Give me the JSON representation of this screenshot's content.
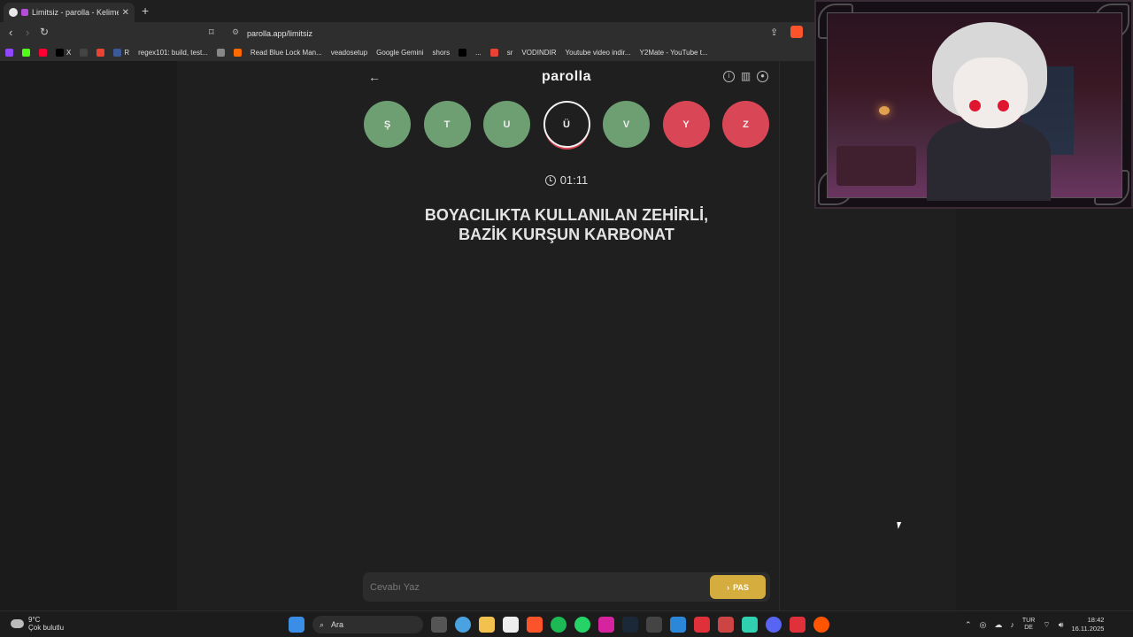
{
  "browser": {
    "tab_title": "Limitsiz - parolla - Kelime oyu",
    "new_tab": "+",
    "url": "parolla.app/limitsiz",
    "bookmarks": [
      {
        "label": "",
        "color": "#9146ff"
      },
      {
        "label": "",
        "color": "#53fc18"
      },
      {
        "label": "",
        "color": "#ff0033"
      },
      {
        "label": "X",
        "color": "#000000"
      },
      {
        "label": "",
        "color": "#444444"
      },
      {
        "label": "",
        "color": "#ea4335"
      },
      {
        "label": "R",
        "color": "#3b5998"
      },
      {
        "label": "regex101: build, test...",
        "color": ""
      },
      {
        "label": "",
        "color": "#888888"
      },
      {
        "label": "",
        "color": "#ff6a00"
      },
      {
        "label": "Read Blue Lock Man...",
        "color": ""
      },
      {
        "label": "veadosetup",
        "color": ""
      },
      {
        "label": "Google Gemini",
        "color": ""
      },
      {
        "label": "shors",
        "color": ""
      },
      {
        "label": "",
        "color": "#000000"
      },
      {
        "label": "...",
        "color": ""
      },
      {
        "label": "",
        "color": "#ea4335"
      },
      {
        "label": "sr",
        "color": ""
      },
      {
        "label": "VODINDIR",
        "color": ""
      },
      {
        "label": "Youtube video indir...",
        "color": ""
      },
      {
        "label": "Y2Mate - YouTube t...",
        "color": ""
      }
    ]
  },
  "app": {
    "logo": "parolla",
    "back_icon": "arrow-left-icon",
    "letters": [
      {
        "char": "Ş",
        "state": "correct"
      },
      {
        "char": "T",
        "state": "correct"
      },
      {
        "char": "U",
        "state": "correct"
      },
      {
        "char": "Ü",
        "state": "active"
      },
      {
        "char": "V",
        "state": "correct"
      },
      {
        "char": "Y",
        "state": "wrong"
      },
      {
        "char": "Z",
        "state": "wrong"
      }
    ],
    "timer": "01:11",
    "question_line1": "BOYACILIKTA KULLANILAN ZEHİRLİ,",
    "question_line2": "BAZİK KURŞUN KARBONAT",
    "answer_placeholder": "Cevabı Yaz",
    "pass_label": "PAS",
    "colors": {
      "correct": "#6e9f72",
      "wrong": "#d94756",
      "pass": "#d4ad3e"
    }
  },
  "taskbar": {
    "temp": "9°C",
    "weather": "Çok bulutlu",
    "search": "Ara",
    "lang1": "TUR",
    "lang2": "DE",
    "time": "18:42",
    "date": "16.11.2025"
  }
}
